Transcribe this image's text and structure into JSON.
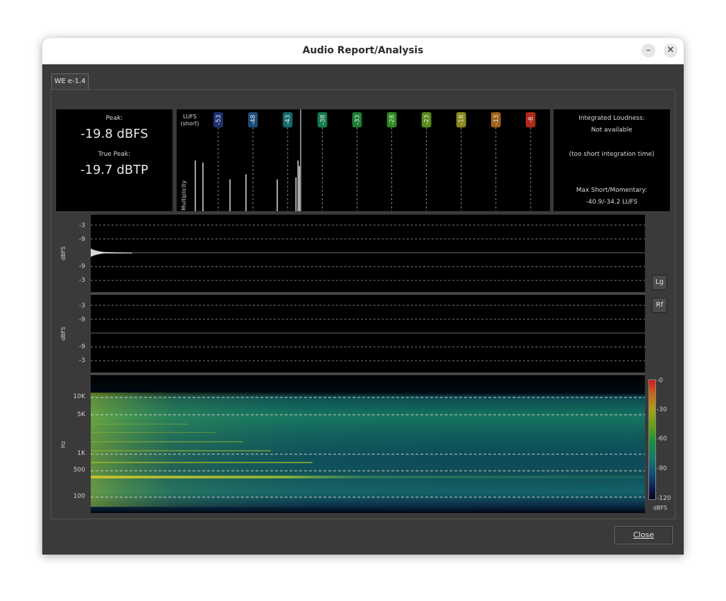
{
  "window": {
    "title": "Audio Report/Analysis",
    "tab_label": "WE e-1.4",
    "close_label": "Close",
    "minimize_glyph": "–",
    "close_glyph": "✕"
  },
  "peak": {
    "peak_label": "Peak:",
    "peak_value": "-19.8 dBFS",
    "true_peak_label": "True Peak:",
    "true_peak_value": "-19.7 dBTP"
  },
  "loudness_histogram": {
    "lufs_label_line1": "LUFS",
    "lufs_label_line2": "(short)",
    "multiplicity_label": "Multiplicity",
    "markers": [
      {
        "label": "-53",
        "color": "#1d2f6f"
      },
      {
        "label": "-48",
        "color": "#1c4b7a"
      },
      {
        "label": "-43",
        "color": "#14686e"
      },
      {
        "label": "-38",
        "color": "#137a4e"
      },
      {
        "label": "-33",
        "color": "#1b7d33"
      },
      {
        "label": "-28",
        "color": "#2f8a1e"
      },
      {
        "label": "-23",
        "color": "#5a8a18"
      },
      {
        "label": "-18",
        "color": "#8a8a1a"
      },
      {
        "label": "-13",
        "color": "#a0601a"
      },
      {
        "label": "-8",
        "color": "#b02a1a"
      }
    ],
    "bars": [
      {
        "lufs": -56.3,
        "height": 0.99
      },
      {
        "lufs": -55.2,
        "height": 0.95
      },
      {
        "lufs": -51.3,
        "height": 0.62
      },
      {
        "lufs": -49.0,
        "height": 0.72
      },
      {
        "lufs": -44.5,
        "height": 0.62
      },
      {
        "lufs": -41.8,
        "height": 0.66
      },
      {
        "lufs": -41.5,
        "height": 0.99
      },
      {
        "lufs": -41.3,
        "height": 0.88
      }
    ]
  },
  "integrated": {
    "title": "Integrated Loudness:",
    "status": "Not available",
    "note": "(too short integration time)",
    "max_label": "Max Short/Momentary:",
    "max_value": "-40.9/-34.2 LUFS"
  },
  "waveform": {
    "y_unit": "dBFS",
    "ticks_top": [
      "-3",
      "-9"
    ],
    "ticks_bottom": [
      "-9",
      "-3"
    ]
  },
  "waveform2": {
    "y_unit": "dBFS",
    "ticks_top": [
      "-3",
      "-9"
    ],
    "ticks_bottom": [
      "-9",
      "-3"
    ]
  },
  "side_buttons": {
    "log_label": "Lg",
    "rect_label": "Rf"
  },
  "spectrogram": {
    "y_unit": "Hz",
    "freq_ticks": [
      "10K",
      "5K",
      "1K",
      "500",
      "100"
    ],
    "colorbar_ticks": [
      "-0",
      "-30",
      "-60",
      "-90",
      "-120"
    ],
    "colorbar_unit": "dBFS"
  }
}
